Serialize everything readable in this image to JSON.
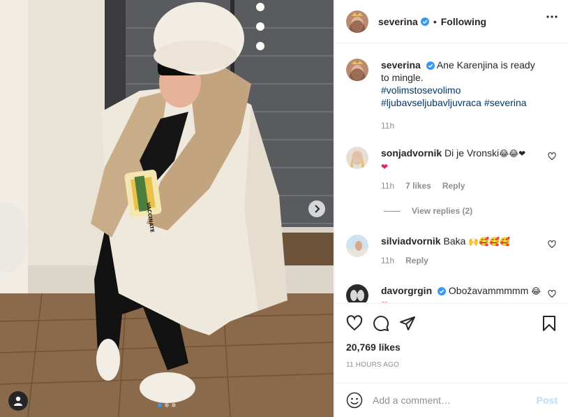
{
  "post": {
    "author": "severina",
    "follow_status": "Following",
    "separator": "•",
    "caption": "Ane Karenjina is ready to mingle.",
    "hashtags": [
      "#volimstosevolimo",
      "#ljubavseljubavljuvraca #severina"
    ],
    "caption_time": "11h",
    "likes": "20,769 likes",
    "time_ago": "11 HOURS AGO"
  },
  "photo": {
    "box_text": "VACCINATE",
    "carousel_index": 1,
    "carousel_count": 3
  },
  "comments": [
    {
      "user": "sonjadvornik",
      "text": "Di je Vronski",
      "emojis": "😂😂❤",
      "emojis_line2": "❤",
      "time": "11h",
      "likes": "7 likes",
      "reply_label": "Reply",
      "view_replies": "View replies (2)"
    },
    {
      "user": "silviadvornik",
      "text": "Baka",
      "emojis": "🙌🥰🥰🥰",
      "time": "11h",
      "reply_label": "Reply"
    },
    {
      "user": "davorgrgin",
      "text": "Obožavammmmm",
      "emojis": "😂",
      "emojis_line2": "❤"
    }
  ],
  "add_comment": {
    "placeholder": "Add a comment…",
    "post_label": "Post"
  },
  "colors": {
    "verified": "#3897f0",
    "link": "#00376b",
    "muted": "#8e8e8e",
    "post_disabled": "#b2dffc"
  },
  "icons": [
    "verified-icon",
    "more-icon",
    "heart-icon",
    "comment-icon",
    "share-icon",
    "bookmark-icon",
    "emoji-icon",
    "next-arrow-icon",
    "user-tag-icon"
  ]
}
